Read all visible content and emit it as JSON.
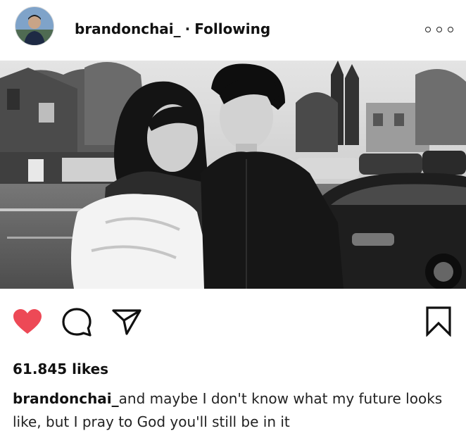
{
  "post": {
    "username": "brandonchai_",
    "separator": "·",
    "follow_status": "Following",
    "likes": "61.845 likes",
    "caption_user": "brandonchai_",
    "caption_text": "and maybe I don't know what my future looks like, but I pray to God you'll still be in it",
    "liked": true
  },
  "icons": {
    "more": "more-options-icon",
    "like": "heart-icon",
    "comment": "comment-icon",
    "share": "paper-plane-icon",
    "save": "bookmark-icon"
  },
  "colors": {
    "like_red": "#ed4956",
    "text": "#111111"
  }
}
